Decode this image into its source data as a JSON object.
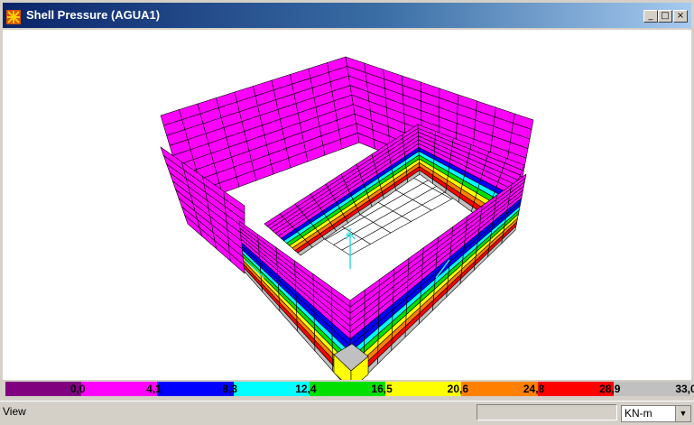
{
  "window": {
    "title": "Shell Pressure (AGUA1)"
  },
  "controls": {
    "minimize": "_",
    "maximize": "□",
    "close": "×"
  },
  "colors": {
    "titlebar_start": "#0a246a",
    "titlebar_end": "#a6caf0",
    "pressure_scale": [
      "#800080",
      "#ff00ff",
      "#0000ff",
      "#00ffff",
      "#00e000",
      "#ffff00",
      "#ff8000",
      "#ff0000",
      "#c0c0c0"
    ]
  },
  "legend": {
    "labels": [
      "0,0",
      "4,1",
      "8,3",
      "12,4",
      "16,5",
      "20,6",
      "24,8",
      "28,9",
      "33,0"
    ]
  },
  "status": {
    "text": "View",
    "units": "KN-m"
  },
  "axis": {
    "z_label": "Z",
    "x_label": "X",
    "y_label": "Y"
  }
}
